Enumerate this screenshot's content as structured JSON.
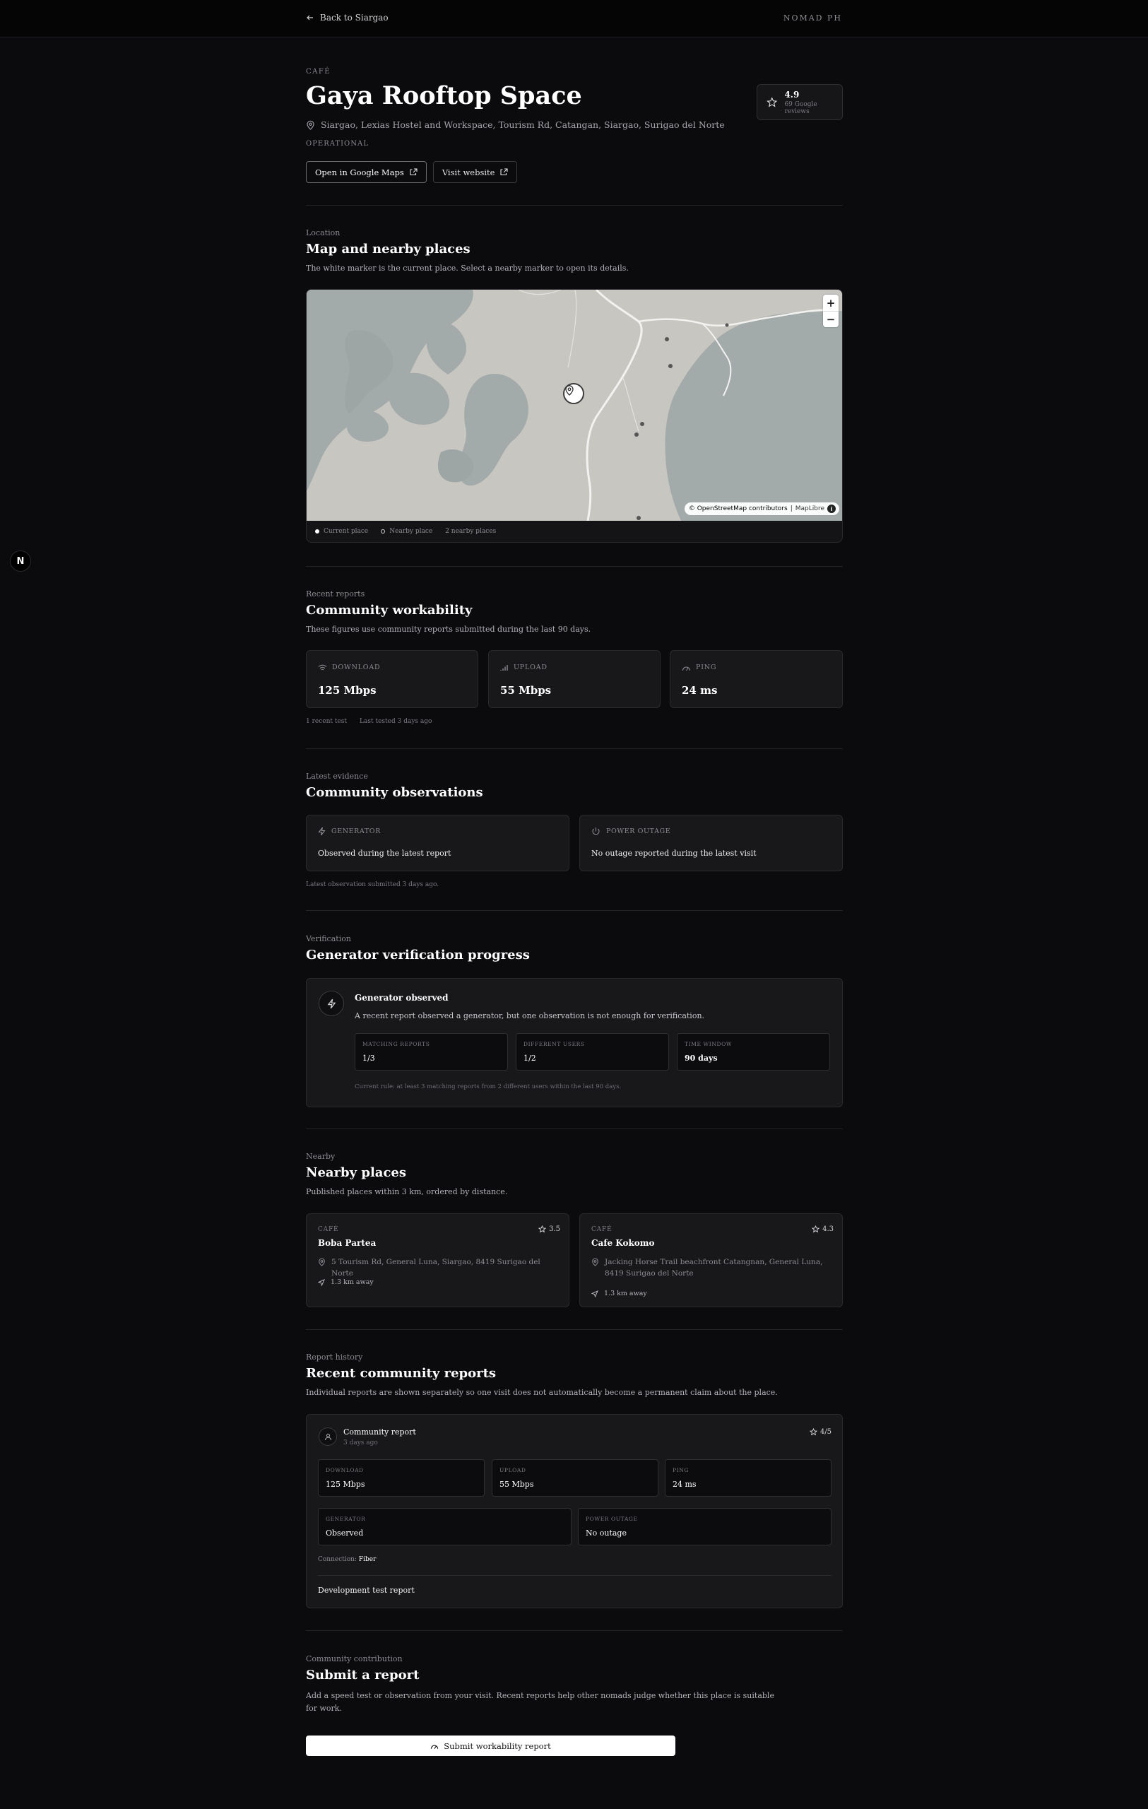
{
  "topbar": {
    "back_label": "Back to Siargao",
    "brand": "NOMAD PH"
  },
  "floating_badge": "N",
  "place": {
    "category": "CAFÉ",
    "name": "Gaya Rooftop Space",
    "address": "Siargao, Lexias Hostel and Workspace, Tourism Rd, Catangan, Siargao, Surigao del Norte",
    "status": "OPERATIONAL",
    "rating": "4.9",
    "reviews": "69 Google reviews",
    "buttons": {
      "maps": "Open in Google Maps",
      "website": "Visit website"
    }
  },
  "map_section": {
    "kicker": "Location",
    "title": "Map and nearby places",
    "description": "The white marker is the current place. Select a nearby marker to open its details.",
    "zoom_in": "+",
    "zoom_out": "−",
    "attribution_prefix": "© OpenStreetMap contributors",
    "attribution_suffix": "MapLibre",
    "info": "i",
    "legend": {
      "current": "Current place",
      "nearby": "Nearby place",
      "count": "2 nearby places"
    }
  },
  "workability": {
    "kicker": "Recent reports",
    "title": "Community workability",
    "description": "These figures use community reports submitted during the last 90 days.",
    "metrics": [
      {
        "label": "DOWNLOAD",
        "value": "125 Mbps",
        "icon": "wifi-icon"
      },
      {
        "label": "UPLOAD",
        "value": "55 Mbps",
        "icon": "signal-bars-icon"
      },
      {
        "label": "PING",
        "value": "24 ms",
        "icon": "gauge-icon"
      }
    ],
    "footer": {
      "tests": "1 recent test",
      "last_tested": "Last tested 3 days ago"
    }
  },
  "observations": {
    "kicker": "Latest evidence",
    "title": "Community observations",
    "items": [
      {
        "label": "GENERATOR",
        "value": "Observed during the latest report",
        "icon": "lightning-icon"
      },
      {
        "label": "POWER OUTAGE",
        "value": "No outage reported during the latest visit",
        "icon": "power-icon"
      }
    ],
    "footer": "Latest observation submitted 3 days ago."
  },
  "verification": {
    "kicker": "Verification",
    "title": "Generator verification progress",
    "card_title": "Generator observed",
    "card_desc": "A recent report observed a generator, but one observation is not enough for verification.",
    "stats": [
      {
        "label": "MATCHING REPORTS",
        "value": "1/3"
      },
      {
        "label": "DIFFERENT USERS",
        "value": "1/2"
      },
      {
        "label": "TIME WINDOW",
        "value": "90 days"
      }
    ],
    "rule": "Current rule: at least 3 matching reports from 2 different users within the last 90 days."
  },
  "nearby": {
    "kicker": "Nearby",
    "title": "Nearby places",
    "description": "Published places within 3 km, ordered by distance.",
    "places": [
      {
        "category": "CAFÉ",
        "rating": "3.5",
        "name": "Boba Partea",
        "address": "5 Tourism Rd, General Luna, Siargao, 8419 Surigao del Norte",
        "distance": "1.3 km away"
      },
      {
        "category": "CAFÉ",
        "rating": "4.3",
        "name": "Cafe Kokomo",
        "address": "Jacking Horse Trail beachfront Catangnan, General Luna, 8419 Surigao del Norte",
        "distance": "1.3 km away"
      }
    ]
  },
  "history": {
    "kicker": "Report history",
    "title": "Recent community reports",
    "description": "Individual reports are shown separately so one visit does not automatically become a permanent claim about the place.",
    "report": {
      "title": "Community report",
      "time": "3 days ago",
      "rating": "4/5",
      "download_label": "DOWNLOAD",
      "download": "125 Mbps",
      "upload_label": "UPLOAD",
      "upload": "55 Mbps",
      "ping_label": "PING",
      "ping": "24 ms",
      "generator_label": "GENERATOR",
      "generator": "Observed",
      "outage_label": "POWER OUTAGE",
      "outage": "No outage",
      "connection_label": "Connection:",
      "connection": "Fiber",
      "note": "Development test report"
    }
  },
  "contribute": {
    "kicker": "Community contribution",
    "title": "Submit a report",
    "description_line1": "Add a speed test or observation from your visit. Recent reports help other nomads judge whether this place is suitable",
    "description_line2": "for work.",
    "button": "Submit workability report"
  },
  "colors": {
    "background": "#0b0b0d",
    "card": "#18181b",
    "border": "#2a2a2e",
    "map_land": "#c7c6c1",
    "map_water": "#a3aaaa"
  }
}
